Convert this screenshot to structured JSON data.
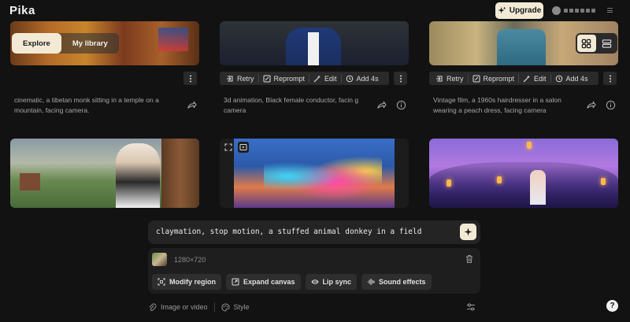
{
  "app": {
    "logo": "Pika"
  },
  "header": {
    "upgrade_label": "Upgrade"
  },
  "mode_tabs": [
    {
      "label": "Explore",
      "active": true
    },
    {
      "label": "My library",
      "active": false
    }
  ],
  "view_modes": [
    "grid-view-icon",
    "list-view-icon"
  ],
  "actions": {
    "retry": "Retry",
    "reprompt": "Reprompt",
    "edit": "Edit",
    "add": "Add 4s"
  },
  "cards": [
    {
      "caption": "cinematic, a tibetan monk sitting in a temple on a mountain, facing camera."
    },
    {
      "caption": "3d animation, Black female conductor, facin g camera"
    },
    {
      "caption": "Vintage film, a 1960s hairdresser in a salon wearing a peach dress, facing camera"
    }
  ],
  "composer": {
    "prompt": "claymation, stop motion, a stuffed animal donkey in a field",
    "resolution": "1280×720",
    "tools": [
      {
        "label": "Modify region",
        "icon": "modify-region-icon"
      },
      {
        "label": "Expand canvas",
        "icon": "expand-canvas-icon"
      },
      {
        "label": "Lip sync",
        "icon": "lip-sync-icon"
      },
      {
        "label": "Sound effects",
        "icon": "sound-effects-icon"
      }
    ],
    "image_or_video": "Image or video",
    "style": "Style"
  },
  "help_label": "?",
  "colors": {
    "background": "#121212",
    "accent": "#f3ead6",
    "panel": "#242424"
  }
}
